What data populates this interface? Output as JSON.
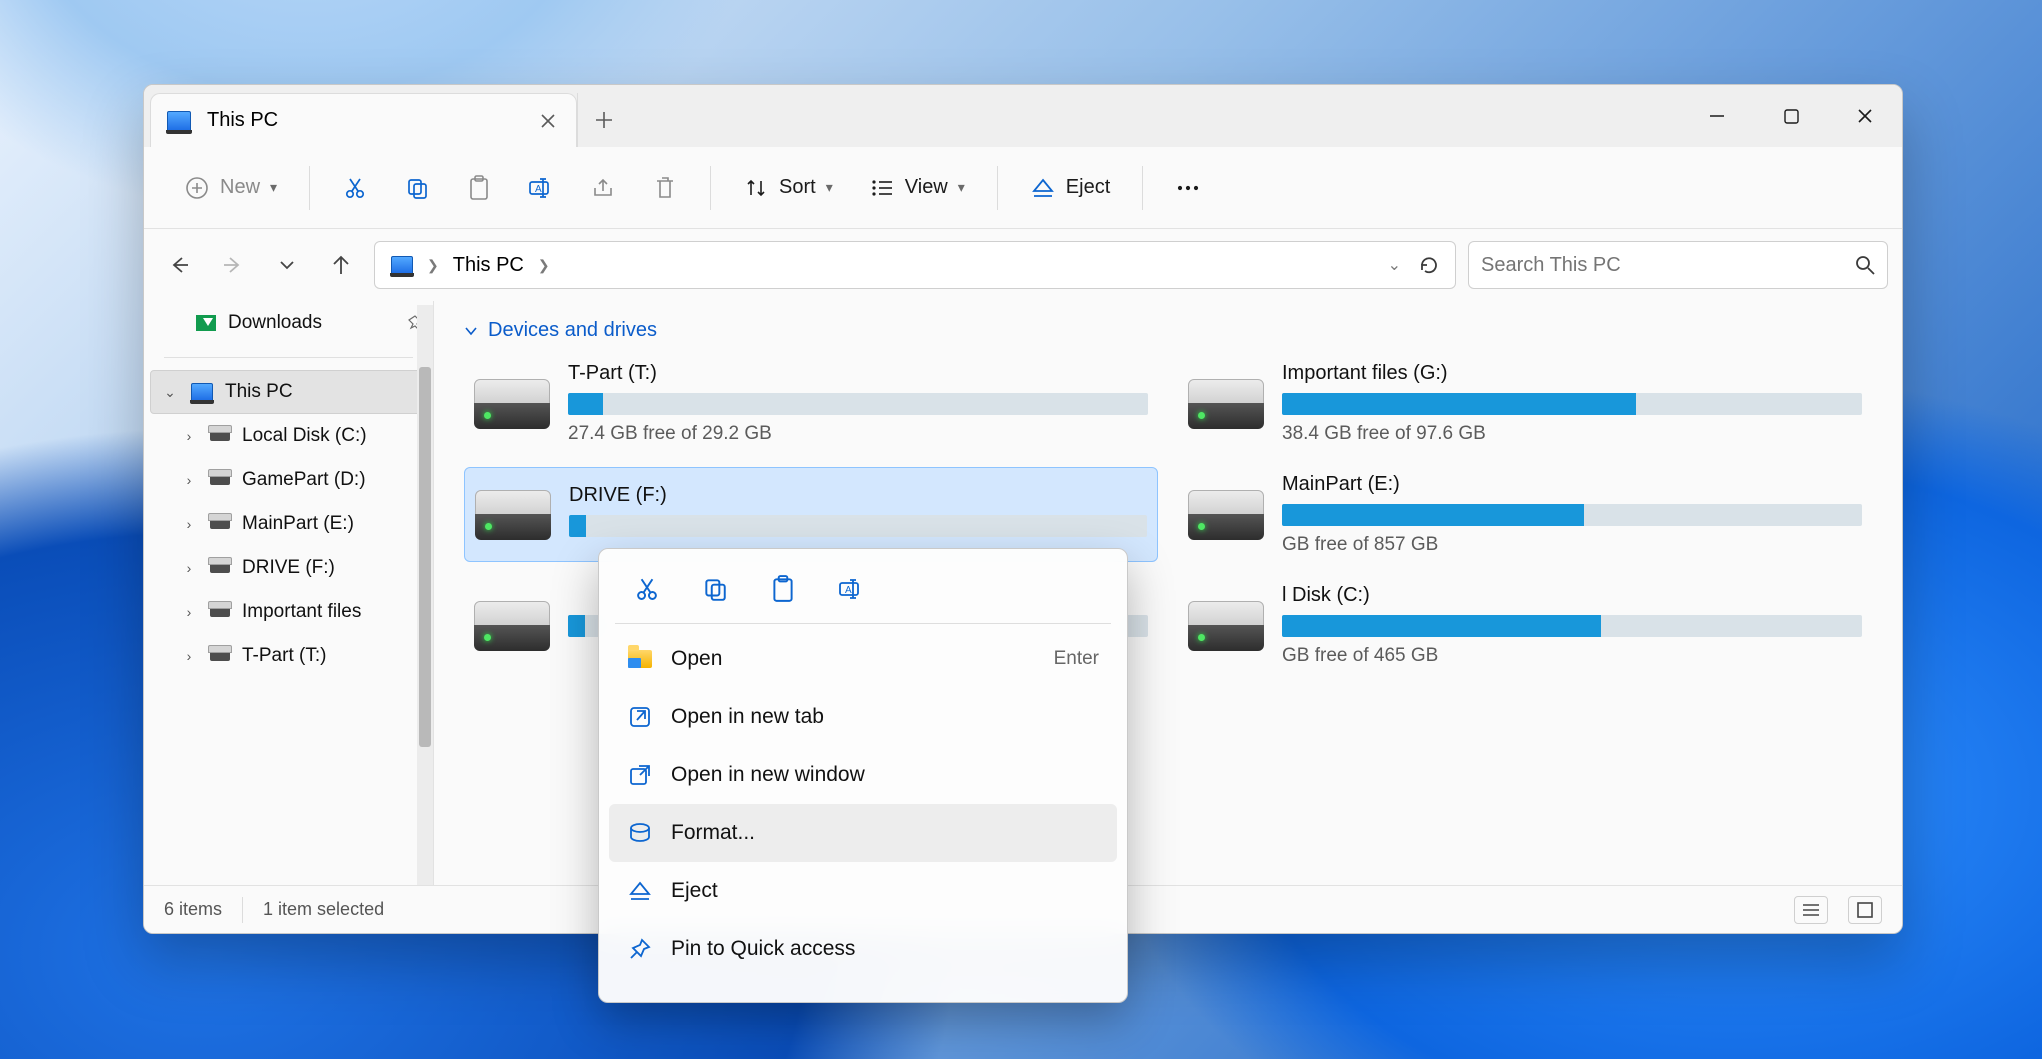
{
  "tab": {
    "title": "This PC"
  },
  "toolbar": {
    "new_label": "New",
    "sort_label": "Sort",
    "view_label": "View",
    "eject_label": "Eject"
  },
  "address": {
    "location": "This PC"
  },
  "search": {
    "placeholder": "Search This PC"
  },
  "sidebar": {
    "downloads": "Downloads",
    "this_pc": "This PC",
    "items": [
      {
        "label": "Local Disk (C:)"
      },
      {
        "label": "GamePart (D:)"
      },
      {
        "label": "MainPart (E:)"
      },
      {
        "label": "DRIVE (F:)"
      },
      {
        "label": "Important files"
      },
      {
        "label": "T-Part (T:)"
      }
    ]
  },
  "section": {
    "header": "Devices and drives"
  },
  "drives": [
    {
      "name": "T-Part (T:)",
      "free": "27.4 GB free of 29.2 GB",
      "pct": 6
    },
    {
      "name": "Important files (G:)",
      "free": "38.4 GB free of 97.6 GB",
      "pct": 61
    },
    {
      "name": "DRIVE (F:)",
      "free": "",
      "pct": 3,
      "selected": true
    },
    {
      "name": "MainPart (E:)",
      "free": "GB free of 857 GB",
      "pct": 52
    },
    {
      "name": "",
      "free": "",
      "pct": 3
    },
    {
      "name": "l Disk (C:)",
      "free": "GB free of 465 GB",
      "pct": 55
    }
  ],
  "status": {
    "count": "6 items",
    "selected": "1 item selected"
  },
  "context_menu": {
    "open": "Open",
    "open_shortcut": "Enter",
    "open_new_tab": "Open in new tab",
    "open_new_window": "Open in new window",
    "format": "Format...",
    "eject": "Eject",
    "pin": "Pin to Quick access"
  }
}
